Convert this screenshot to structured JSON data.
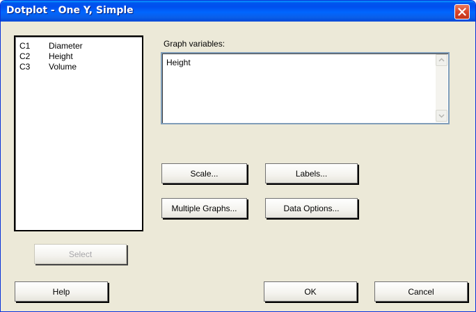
{
  "window": {
    "title": "Dotplot - One Y, Simple"
  },
  "variables": [
    {
      "column": "C1",
      "name": "Diameter"
    },
    {
      "column": "C2",
      "name": "Height"
    },
    {
      "column": "C3",
      "name": "Volume"
    }
  ],
  "graph_variables": {
    "label": "Graph variables:",
    "value": "Height"
  },
  "buttons": {
    "scale": "Scale...",
    "labels": "Labels...",
    "multiple_graphs": "Multiple Graphs...",
    "data_options": "Data Options...",
    "select": "Select",
    "help": "Help",
    "ok": "OK",
    "cancel": "Cancel"
  },
  "icons": {
    "close": "close-icon",
    "scroll_up": "scroll-up-icon",
    "scroll_down": "scroll-down-icon"
  },
  "colors": {
    "titlebar": "#0053ee",
    "dialog_bg": "#ece9d8",
    "close": "#d8462a"
  }
}
